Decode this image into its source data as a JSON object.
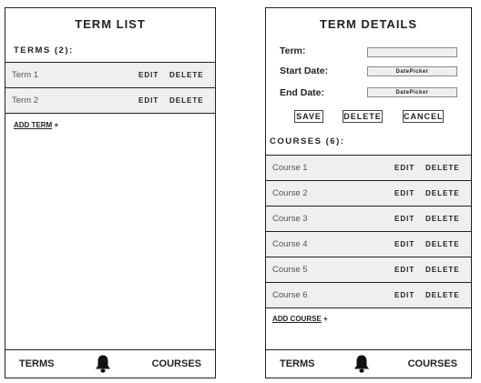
{
  "term_list": {
    "title": "TERM LIST",
    "section_label": "TERMS (2):",
    "terms": [
      {
        "name": "Term 1",
        "edit": "EDIT",
        "delete": "DELETE"
      },
      {
        "name": "Term 2",
        "edit": "EDIT",
        "delete": "DELETE"
      }
    ],
    "add_link": "ADD TERM",
    "add_plus": "+"
  },
  "term_details": {
    "title": "TERM DETAILS",
    "fields": {
      "term_label": "Term:",
      "term_value": "",
      "start_label": "Start Date:",
      "start_value": "DatePicker",
      "end_label": "End Date:",
      "end_value": "DatePicker"
    },
    "buttons": {
      "save": "SAVE",
      "delete": "DELETE",
      "cancel": "CANCEL"
    },
    "section_label": "COURSES (6):",
    "courses": [
      {
        "name": "Course 1",
        "edit": "EDIT",
        "delete": "DELETE"
      },
      {
        "name": "Course 2",
        "edit": "EDIT",
        "delete": "DELETE"
      },
      {
        "name": "Course 3",
        "edit": "EDIT",
        "delete": "DELETE"
      },
      {
        "name": "Course 4",
        "edit": "EDIT",
        "delete": "DELETE"
      },
      {
        "name": "Course 5",
        "edit": "EDIT",
        "delete": "DELETE"
      },
      {
        "name": "Course 6",
        "edit": "EDIT",
        "delete": "DELETE"
      }
    ],
    "add_link": "ADD COURSE",
    "add_plus": "+"
  },
  "footer": {
    "terms": "TERMS",
    "bell_icon": "bell-icon",
    "courses": "COURSES"
  }
}
